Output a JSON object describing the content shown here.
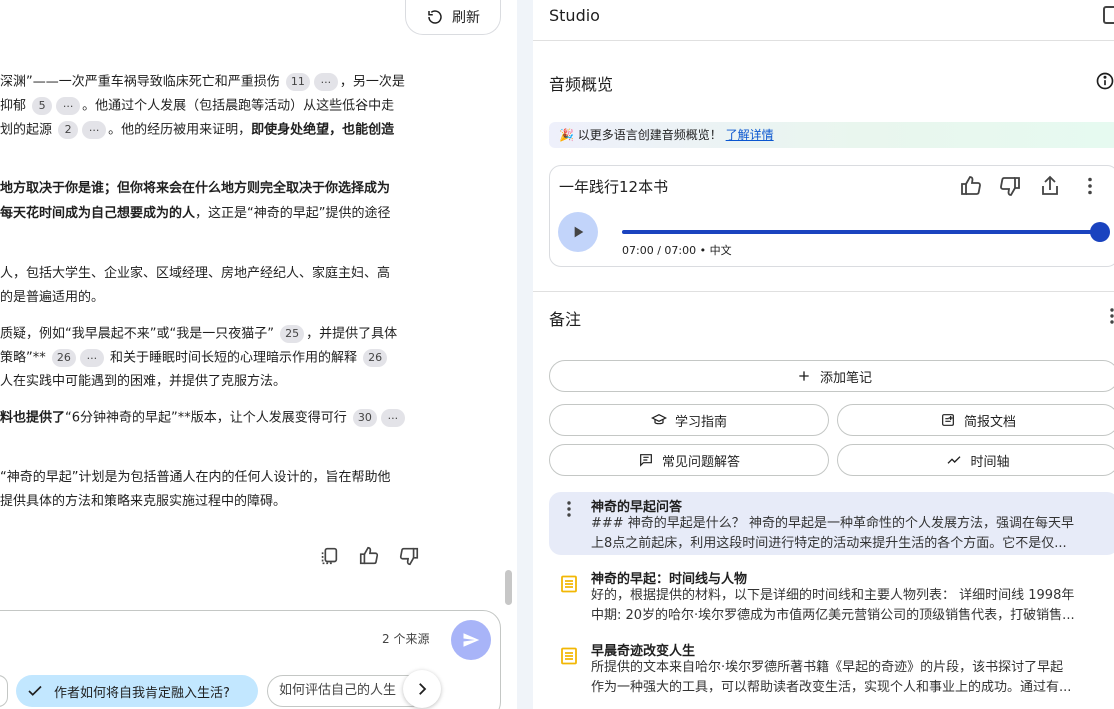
{
  "chat": {
    "refresh_label": "刷新",
    "lines": [
      {
        "segments": [
          {
            "t": "深渊”——一次严重车祸导致临床死亡和严重损伤 "
          },
          {
            "cite": "11"
          },
          {
            "more": "..."
          },
          {
            "t": "，另一次是"
          }
        ]
      },
      {
        "segments": [
          {
            "t": "抑郁 "
          },
          {
            "cite": "5"
          },
          {
            "more": "..."
          },
          {
            "t": "。他通过个人发展（包括晨跑等活动）从这些低谷中走"
          }
        ]
      },
      {
        "segments": [
          {
            "t": "划的起源 "
          },
          {
            "cite": "2"
          },
          {
            "more": "..."
          },
          {
            "t": "。他的经历被用来证明，"
          },
          {
            "b": "即使身处绝望，也能创造"
          }
        ]
      },
      {
        "segments": [
          {
            "b": "地方取决于你是谁；但你将来会在什么地方则完全取决于你选择成为"
          }
        ]
      },
      {
        "segments": [
          {
            "b": "每天花时间成为自己想要成为的人"
          },
          {
            "t": "，这正是“神奇的早起”提供的途径"
          }
        ]
      },
      {
        "segments": [
          {
            "t": "人，包括大学生、企业家、区域经理、房地产经纪人、家庭主妇、高"
          }
        ]
      },
      {
        "segments": [
          {
            "t": "的是普遍适用的。"
          }
        ]
      },
      {
        "segments": [
          {
            "t": "质疑，例如“我早晨起不来”或“我是一只夜猫子” "
          },
          {
            "cite": "25"
          },
          {
            "t": "，并提供了具体"
          }
        ]
      },
      {
        "segments": [
          {
            "t": "策略”** "
          },
          {
            "cite": "26"
          },
          {
            "more": "..."
          },
          {
            "t": " 和关于睡眠时间长短的心理暗示作用的解释 "
          },
          {
            "cite": "26"
          }
        ]
      },
      {
        "segments": [
          {
            "t": "人在实践中可能遇到的困难，并提供了克服方法。"
          }
        ]
      },
      {
        "segments": [
          {
            "b": "料也提供了"
          },
          {
            "t": "“6分钟神奇的早起”**版本，让个人发展变得可行 "
          },
          {
            "cite": "30"
          },
          {
            "more": "..."
          }
        ]
      },
      {
        "segments": [
          {
            "t": "“神奇的早起”计划是为包括普通人在内的任何人设计的，旨在帮助他"
          }
        ]
      },
      {
        "segments": [
          {
            "t": "提供具体的方法和策略来克服实施过程中的障碍。"
          }
        ]
      }
    ],
    "source_count": "2 个来源",
    "chips": [
      "作者如何将自我肯定融入生活?",
      "如何评估自己的人生"
    ]
  },
  "studio": {
    "title": "Studio",
    "audio_overview": {
      "title": "音频概览",
      "banner_text": "以更多语言创建音频概览！",
      "banner_link": "了解详情",
      "card": {
        "name": "一年践行12本书",
        "time": "07:00 / 07:00 • 中文",
        "progress": 1.0
      }
    },
    "notes": {
      "title": "备注",
      "add_note": "添加笔记",
      "buttons": [
        "学习指南",
        "简报文档",
        "常见问题解答",
        "时间轴"
      ],
      "items": [
        {
          "title": "神奇的早起问答",
          "lines": [
            "### 神奇的早起是什么？ 神奇的早起是一种革命性的个人发展方法，强调在每天早",
            "上8点之前起床，利用这段时间进行特定的活动来提升生活的各个方面。它不是仅..."
          ]
        },
        {
          "title": "神奇的早起：时间线与人物",
          "lines": [
            "好的，根据提供的材料，以下是详细的时间线和主要人物列表： 详细时间线 1998年",
            "中期: 20岁的哈尔·埃尔罗德成为市值两亿美元营销公司的顶级销售代表，打破销售..."
          ]
        },
        {
          "title": "早晨奇迹改变人生",
          "lines": [
            "所提供的文本来自哈尔·埃尔罗德所著书籍《早起的奇迹》的片段，该书探讨了早起",
            "作为一种强大的工具，可以帮助读者改变生活，实现个人和事业上的成功。通过有..."
          ]
        }
      ]
    }
  },
  "colors": {
    "accent": "#1a43bf",
    "chip_active": "#c2e7ff",
    "note_selected": "#e7ebf8",
    "note_icon": "#f2b705",
    "link": "#0b57d0"
  }
}
